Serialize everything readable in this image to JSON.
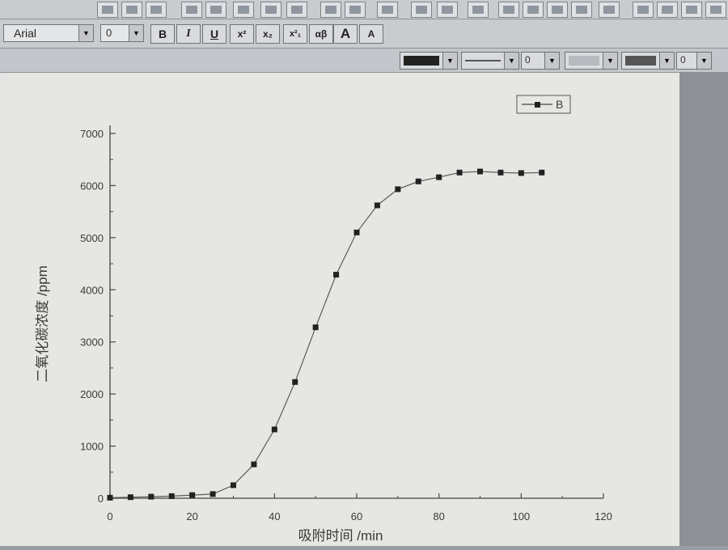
{
  "toolbar": {
    "font_name": "Arial",
    "font_size": "0",
    "buttons": {
      "bold": "B",
      "italic": "I",
      "underline": "U",
      "superscript": "x²",
      "subscript": "x₂",
      "super_sub": "x²₁",
      "greek": "αβ",
      "increase_font": "A",
      "decrease_font": "A"
    },
    "line_width_value": "0",
    "pattern_value": "0"
  },
  "chart_data": {
    "type": "line",
    "title": "",
    "xlabel": "吸附时间 /min",
    "ylabel": "二氧化碳浓度 /ppm",
    "xlim": [
      0,
      120
    ],
    "ylim": [
      0,
      7000
    ],
    "x_ticks": [
      0,
      20,
      40,
      60,
      80,
      100,
      120
    ],
    "y_ticks": [
      0,
      1000,
      2000,
      3000,
      4000,
      5000,
      6000,
      7000
    ],
    "x_tick_labels": [
      "0",
      "20",
      "40",
      "60",
      "80",
      "100",
      "120"
    ],
    "y_tick_labels": [
      "0",
      "1000",
      "2000",
      "3000",
      "4000",
      "5000",
      "6000",
      "7000"
    ],
    "grid": false,
    "legend": {
      "position": "top-right",
      "entries": [
        "B"
      ]
    },
    "series": [
      {
        "name": "B",
        "marker": "square",
        "color": "#222222",
        "x": [
          0,
          5,
          10,
          15,
          20,
          25,
          30,
          35,
          40,
          45,
          50,
          55,
          60,
          65,
          70,
          75,
          80,
          85,
          90,
          95,
          100,
          105
        ],
        "y": [
          10,
          20,
          30,
          40,
          60,
          80,
          250,
          650,
          1320,
          2230,
          3280,
          4290,
          5100,
          5620,
          5930,
          6080,
          6160,
          6250,
          6270,
          6250,
          6240,
          6250
        ]
      }
    ]
  }
}
